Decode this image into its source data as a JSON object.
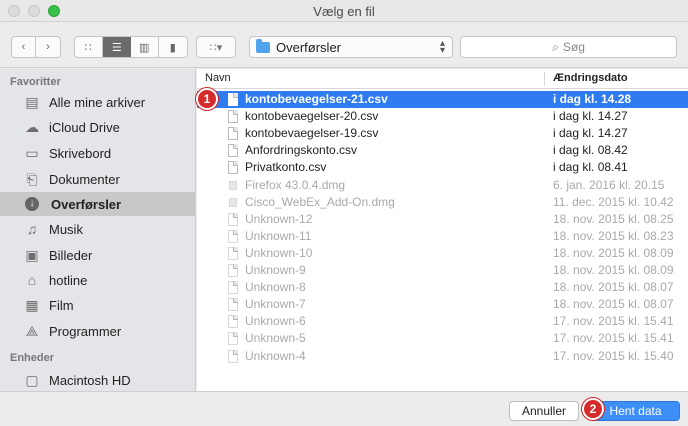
{
  "window": {
    "title": "Vælg en fil"
  },
  "toolbar": {
    "back_icon": "chevron-left-icon",
    "forward_icon": "chevron-right-icon",
    "path": "Overførsler",
    "search_placeholder": "Søg"
  },
  "sidebar": {
    "favorites_header": "Favoritter",
    "favorites": [
      {
        "label": "Alle mine arkiver",
        "icon": "all-files-icon"
      },
      {
        "label": "iCloud Drive",
        "icon": "cloud-icon"
      },
      {
        "label": "Skrivebord",
        "icon": "desktop-icon"
      },
      {
        "label": "Dokumenter",
        "icon": "documents-icon"
      },
      {
        "label": "Overførsler",
        "icon": "downloads-icon",
        "selected": true
      },
      {
        "label": "Musik",
        "icon": "music-icon"
      },
      {
        "label": "Billeder",
        "icon": "camera-icon"
      },
      {
        "label": "hotline",
        "icon": "home-icon"
      },
      {
        "label": "Film",
        "icon": "film-icon"
      },
      {
        "label": "Programmer",
        "icon": "apps-icon"
      }
    ],
    "devices_header": "Enheder",
    "devices": [
      {
        "label": "Macintosh HD",
        "icon": "hard-drive-icon"
      }
    ]
  },
  "list": {
    "col_name": "Navn",
    "col_date": "Ændringsdato",
    "rows": [
      {
        "name": "kontobevaegelser-21.csv",
        "date": "i dag kl. 14.28",
        "state": "selected"
      },
      {
        "name": "kontobevaegelser-20.csv",
        "date": "i dag kl. 14.27",
        "state": "normal"
      },
      {
        "name": "kontobevaegelser-19.csv",
        "date": "i dag kl. 14.27",
        "state": "normal"
      },
      {
        "name": "Anfordringskonto.csv",
        "date": "i dag kl. 08.42",
        "state": "normal"
      },
      {
        "name": "Privatkonto.csv",
        "date": "i dag kl. 08.41",
        "state": "normal"
      },
      {
        "name": "Firefox 43.0.4.dmg",
        "date": "6. jan. 2016 kl. 20.15",
        "state": "dim-dmg"
      },
      {
        "name": "Cisco_WebEx_Add-On.dmg",
        "date": "11. dec. 2015 kl. 10.42",
        "state": "dim-dmg"
      },
      {
        "name": "Unknown-12",
        "date": "18. nov. 2015 kl. 08.25",
        "state": "dim"
      },
      {
        "name": "Unknown-11",
        "date": "18. nov. 2015 kl. 08.23",
        "state": "dim"
      },
      {
        "name": "Unknown-10",
        "date": "18. nov. 2015 kl. 08.09",
        "state": "dim"
      },
      {
        "name": "Unknown-9",
        "date": "18. nov. 2015 kl. 08.09",
        "state": "dim"
      },
      {
        "name": "Unknown-8",
        "date": "18. nov. 2015 kl. 08.07",
        "state": "dim"
      },
      {
        "name": "Unknown-7",
        "date": "18. nov. 2015 kl. 08.07",
        "state": "dim"
      },
      {
        "name": "Unknown-6",
        "date": "17. nov. 2015 kl. 15.41",
        "state": "dim"
      },
      {
        "name": "Unknown-5",
        "date": "17. nov. 2015 kl. 15.41",
        "state": "dim"
      },
      {
        "name": "Unknown-4",
        "date": "17. nov. 2015 kl. 15.40",
        "state": "dim"
      }
    ]
  },
  "footer": {
    "cancel_label": "Annuller",
    "confirm_label": "Hent data"
  },
  "badges": {
    "step1": "1",
    "step2": "2"
  },
  "colors": {
    "selection": "#2f7cf0",
    "primary_button": "#3d8ef7",
    "badge": "#d62b2b"
  }
}
